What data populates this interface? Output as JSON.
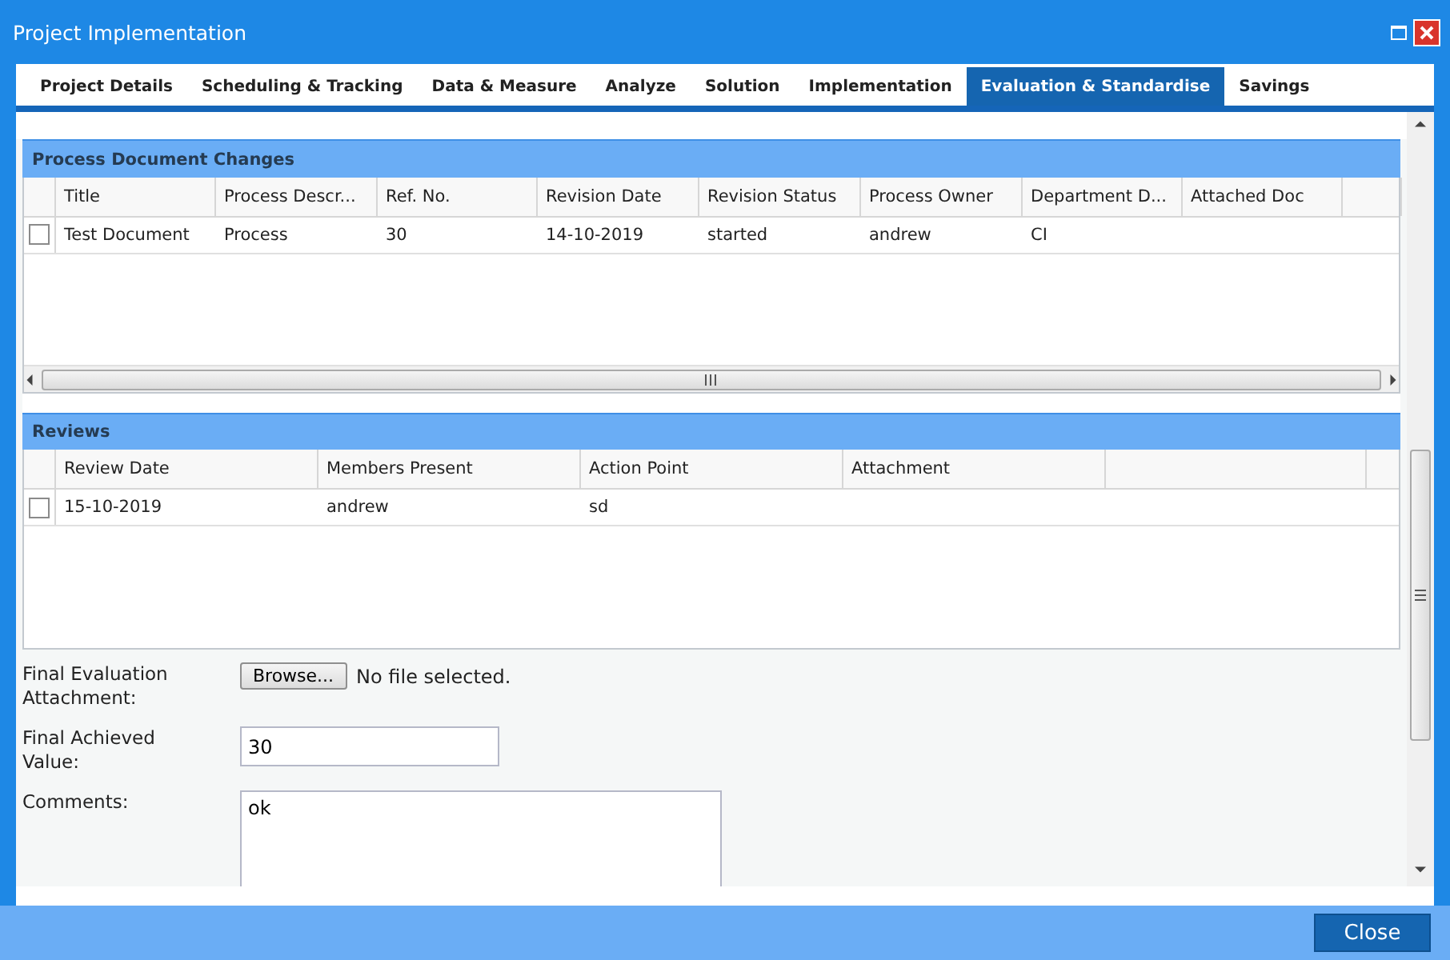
{
  "window": {
    "title": "Project Implementation"
  },
  "tabs": [
    {
      "label": "Project Details",
      "selected": false
    },
    {
      "label": "Scheduling & Tracking",
      "selected": false
    },
    {
      "label": "Data & Measure",
      "selected": false
    },
    {
      "label": "Analyze",
      "selected": false
    },
    {
      "label": "Solution",
      "selected": false
    },
    {
      "label": "Implementation",
      "selected": false
    },
    {
      "label": "Evaluation & Standardise",
      "selected": true
    },
    {
      "label": "Savings",
      "selected": false
    }
  ],
  "document_changes": {
    "title": "Process Document Changes",
    "columns": [
      "Title",
      "Process Descr...",
      "Ref. No.",
      "Revision Date",
      "Revision Status",
      "Process Owner",
      "Department D...",
      "Attached Doc"
    ],
    "rows": [
      {
        "checked": false,
        "cells": [
          "Test Document",
          "Process",
          "30",
          "14-10-2019",
          "started",
          "andrew",
          "CI",
          ""
        ]
      }
    ]
  },
  "reviews": {
    "title": "Reviews",
    "columns": [
      "Review Date",
      "Members Present",
      "Action Point",
      "Attachment"
    ],
    "rows": [
      {
        "checked": false,
        "cells": [
          "15-10-2019",
          "andrew",
          "sd",
          ""
        ]
      }
    ]
  },
  "form": {
    "attachment": {
      "label": "Final Evaluation Attachment:",
      "button": "Browse...",
      "status": "No file selected."
    },
    "achieved": {
      "label": "Final Achieved Value:",
      "value": "30"
    },
    "comments": {
      "label": "Comments:",
      "value": "ok"
    }
  },
  "footer": {
    "button": "Close"
  }
}
